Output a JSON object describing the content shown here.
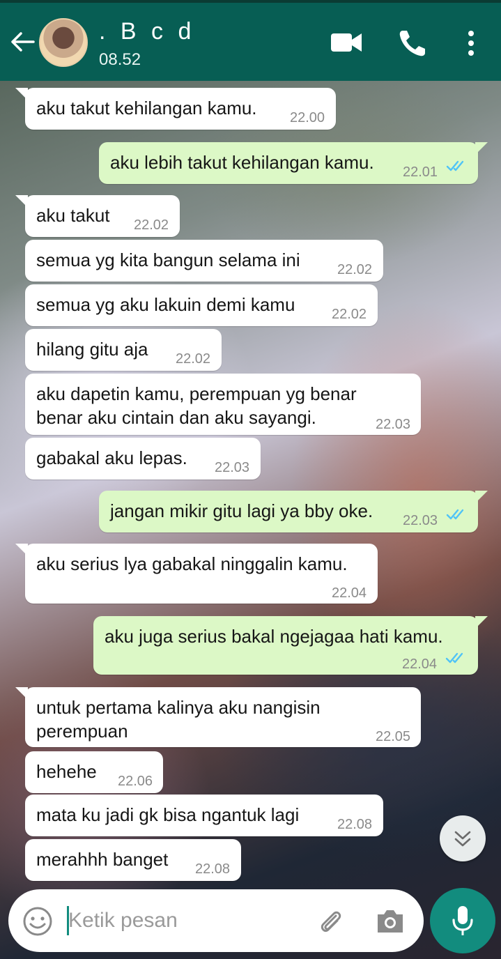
{
  "header": {
    "contact_name": ". B c d",
    "status": "08.52"
  },
  "input": {
    "placeholder": "Ketik pesan"
  },
  "icons": [
    "back-arrow-icon",
    "video-call-icon",
    "phone-icon",
    "more-vert-icon",
    "emoji-icon",
    "attach-icon",
    "camera-icon",
    "mic-icon",
    "chevron-double-down-icon",
    "double-check-icon"
  ],
  "colors": {
    "header": "#075e54",
    "outgoing_bubble": "#dcf8c6",
    "incoming_bubble": "#ffffff",
    "read_ticks": "#4fc3f7",
    "mic_button": "#128c7e"
  },
  "messages": [
    {
      "dir": "in",
      "text": "aku takut kehilangan kamu.",
      "time": "22.00"
    },
    {
      "dir": "out",
      "text": "aku lebih takut kehilangan kamu.",
      "time": "22.01",
      "read": true
    },
    {
      "dir": "in",
      "text": "aku takut",
      "time": "22.02"
    },
    {
      "dir": "in",
      "text": "semua yg kita bangun selama ini",
      "time": "22.02"
    },
    {
      "dir": "in",
      "text": "semua yg aku lakuin demi kamu",
      "time": "22.02"
    },
    {
      "dir": "in",
      "text": "hilang gitu aja",
      "time": "22.02"
    },
    {
      "dir": "in",
      "text": "aku dapetin kamu, perempuan yg benar benar aku cintain dan aku sayangi.",
      "time": "22.03"
    },
    {
      "dir": "in",
      "text": "gabakal aku lepas.",
      "time": "22.03"
    },
    {
      "dir": "out",
      "text": "jangan mikir gitu lagi ya bby oke.",
      "time": "22.03",
      "read": true
    },
    {
      "dir": "in",
      "text": "aku serius lya gabakal ninggalin kamu.",
      "time": "22.04"
    },
    {
      "dir": "out",
      "text": "aku juga serius bakal ngejagaa hati kamu.",
      "time": "22.04",
      "read": true
    },
    {
      "dir": "in",
      "text": "untuk pertama kalinya aku nangisin perempuan",
      "time": "22.05"
    },
    {
      "dir": "in",
      "text": "hehehe",
      "time": "22.06"
    },
    {
      "dir": "in",
      "text": "mata ku jadi gk bisa ngantuk lagi",
      "time": "22.08"
    },
    {
      "dir": "in",
      "text": "merahhh banget",
      "time": "22.08"
    }
  ]
}
